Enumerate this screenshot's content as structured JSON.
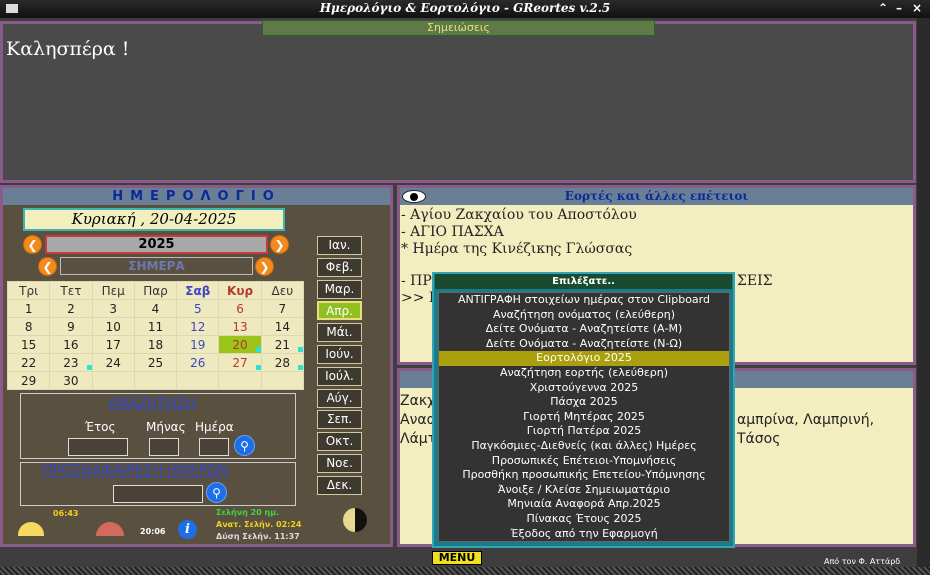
{
  "window": {
    "title": "Ημερολόγιο & Εορτολόγιο - GReortes v.2.5",
    "controls": [
      "⌃",
      "–",
      "×"
    ]
  },
  "notes": {
    "header": "Σημειώσεις",
    "text": "Καλησπέρα !"
  },
  "calendar": {
    "title": "ΗΜΕΡΟΛΟΓΙΟ",
    "date": "Κυριακή , 20-04-2025",
    "year": "2025",
    "today_label": "ΣΗΜΕΡΑ",
    "weekdays": [
      "Τρι",
      "Τετ",
      "Πεμ",
      "Παρ",
      "Σαβ",
      "Κυρ",
      "Δευ"
    ],
    "rows": [
      [
        "1",
        "2",
        "3",
        "4",
        "5",
        "6",
        "7"
      ],
      [
        "8",
        "9",
        "10",
        "11",
        "12",
        "13",
        "14"
      ],
      [
        "15",
        "16",
        "17",
        "18",
        "19",
        "20",
        "21"
      ],
      [
        "22",
        "23",
        "24",
        "25",
        "26",
        "27",
        "28"
      ],
      [
        "29",
        "30",
        "",
        "",
        "",
        "",
        ""
      ]
    ],
    "months": [
      "Ιαν.",
      "Φεβ.",
      "Μαρ.",
      "Απρ.",
      "Μάι.",
      "Ιούν.",
      "Ιούλ.",
      "Αύγ.",
      "Σεπ.",
      "Οκτ.",
      "Νοε.",
      "Δεκ."
    ],
    "selected_month": "Απρ."
  },
  "search": {
    "title": "ΑΝΑΖΗΤΗΣΗ",
    "year_label": "Έτος",
    "month_label": "Μήνας",
    "day_label": "Ημέρα"
  },
  "addsub": {
    "title": "ΠΡΟΣΘΑΦΑΙΡΕΣΗ ΗΜΕΡΩΝ"
  },
  "sun": {
    "sunrise": "06:43",
    "sunset": "20:06"
  },
  "moon": {
    "age": "Σελήνη 20 ημ.",
    "rise": "Ανατ. Σελήν. 02:24",
    "set": "Δύση Σελήν. 11:37"
  },
  "events": {
    "header": "Εορτές και άλλες επέτειοι",
    "lines": [
      "- Αγίου Ζακχαίου του Αποστόλου",
      "- ΑΓΙΟ ΠΑΣΧΑ",
      "* Ημέρα της Κινέζικης Γλώσσας",
      "- ΠΡ",
      "ΣΕΙΣ",
      ">> Γ"
    ]
  },
  "names": {
    "lines": [
      "Ζακχ",
      "Αναα",
      "Λάμτ",
      "αμπρίνα, Λαμπρινή,",
      "Τάσος"
    ]
  },
  "popup": {
    "title": "Επιλέξατε..",
    "items": [
      "ΑΝΤΙΓΡΑΦΗ στοιχείων ημέρας στον Clipboard",
      "Αναζήτηση ονόματος (ελεύθερη)",
      "Δείτε Ονόματα - Αναζητείστε (Α-Μ)",
      "Δείτε Ονόματα - Αναζητείστε (Ν-Ω)",
      "Εορτολόγιο 2025",
      "Αναζήτηση εορτής (ελεύθερη)",
      "Χριστούγεννα 2025",
      "Πάσχα 2025",
      "Γιορτή Μητέρας 2025",
      "Γιορτή Πατέρα 2025",
      "Παγκόσμιες-Διεθνείς (και άλλες) Ημέρες",
      "Προσωπικές Επέτειοι-Υπομνήσεις",
      "Προσθήκη προσωπικής Επετείου-Υπόμνησης",
      "Άνοιξε / Κλείσε Σημειωματάριο",
      "Μηνιαία Αναφορά Απρ.2025",
      "Πίνακας Έτους 2025",
      "Έξοδος από την Εφαρμογή"
    ],
    "selected_index": 4
  },
  "footer": {
    "menu": "MENU",
    "credit": "Από τον Φ. Αττάρδ"
  },
  "colors": {
    "accent_green": "#8fbf20",
    "frame": "#8a5b8a",
    "header_blue": "#6a7e95",
    "popup": "#1a7c8a"
  }
}
